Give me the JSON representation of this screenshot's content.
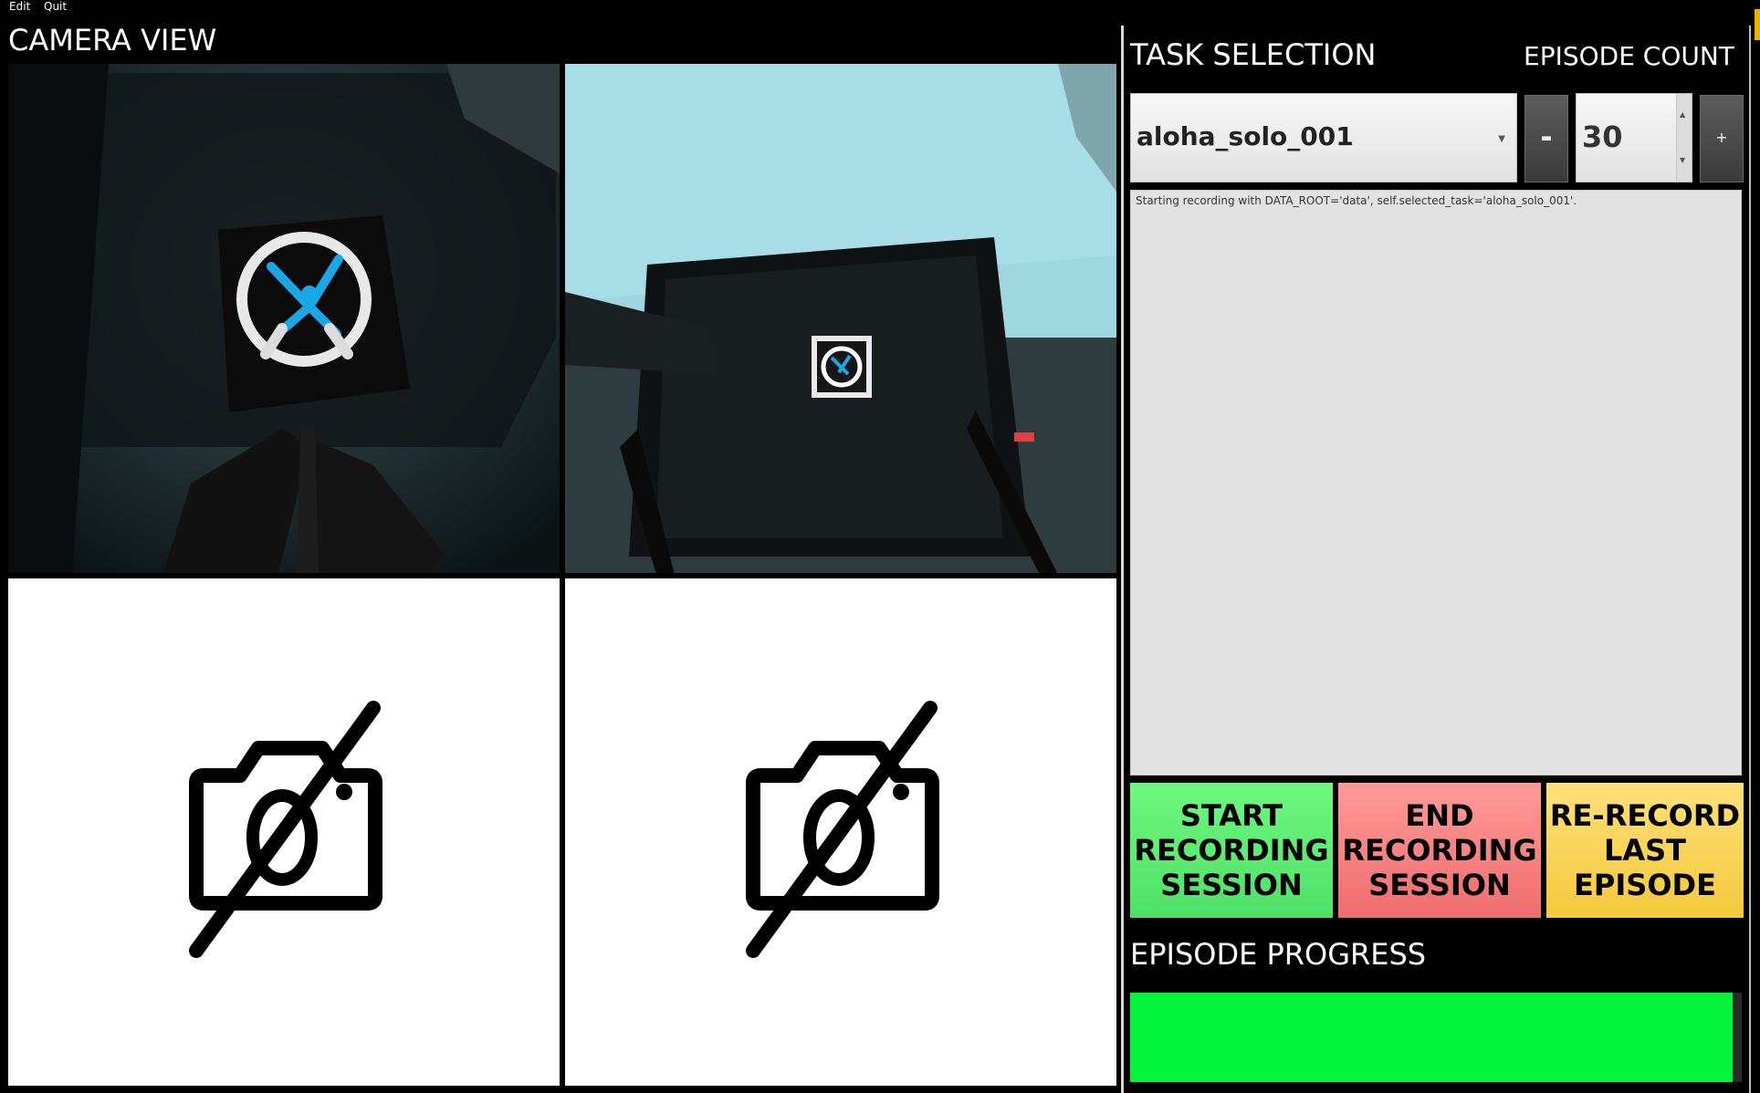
{
  "menubar": {
    "items": [
      "Edit",
      "Quit"
    ]
  },
  "camera_view": {
    "title": "CAMERA VIEW",
    "feeds": [
      {
        "state": "live",
        "icon": "camera-feed-wrist-icon"
      },
      {
        "state": "live",
        "icon": "camera-feed-overhead-icon"
      },
      {
        "state": "unavailable",
        "icon": "camera-off-icon"
      },
      {
        "state": "unavailable",
        "icon": "camera-off-icon"
      }
    ]
  },
  "task_selection": {
    "title": "TASK SELECTION",
    "selected_task": "aloha_solo_001"
  },
  "episode_count": {
    "title": "EPISODE COUNT",
    "value": "30",
    "decrement_label": "-",
    "increment_label": "+"
  },
  "log": {
    "lines": [
      "Starting recording with DATA_ROOT='data', self.selected_task='aloha_solo_001'."
    ]
  },
  "actions": {
    "start": "START\nRECORDING\nSESSION",
    "end": "END\nRECORDING\nSESSION",
    "rerecord": "RE-RECORD\nLAST\nEPISODE"
  },
  "episode_progress": {
    "title": "EPISODE PROGRESS",
    "fraction": 0.985
  },
  "colors": {
    "start": "#5cef72",
    "end": "#f78282",
    "rerecord": "#fbd55a",
    "progress": "#04f43c"
  }
}
